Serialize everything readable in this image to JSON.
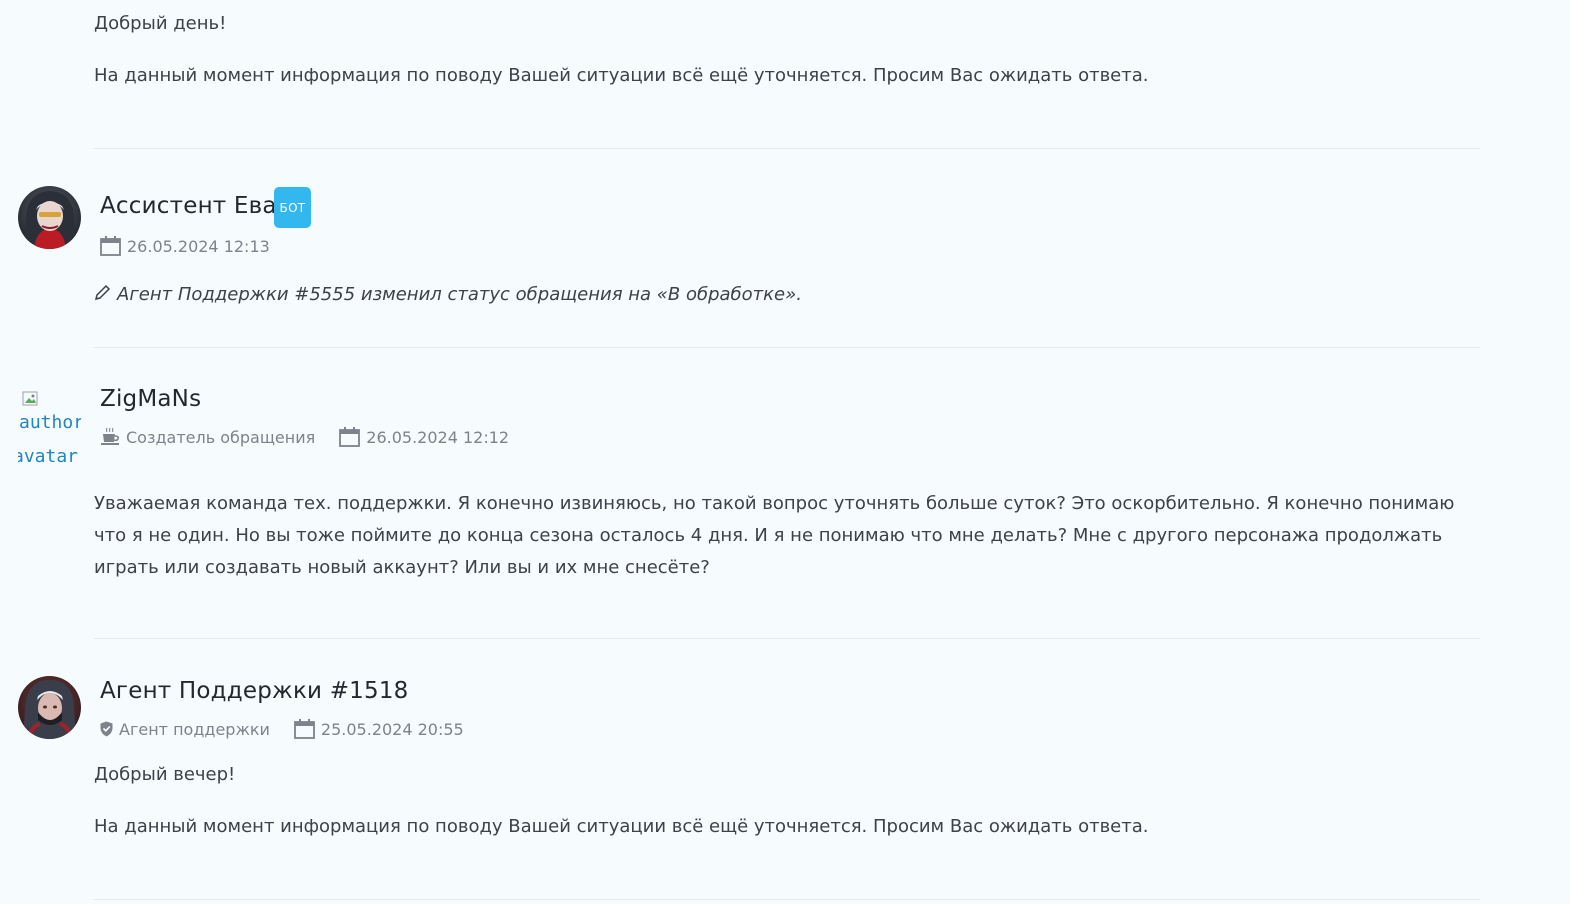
{
  "posts": [
    {
      "body": {
        "greeting": "Добрый день!",
        "text": "На данный момент информация по поводу Вашей ситуации всё ещё уточняется. Просим Вас ожидать ответа."
      }
    },
    {
      "author": "Ассистент Ева",
      "badge": "БОТ",
      "date": "26.05.2024 12:13",
      "status_note": "Агент Поддержки #5555 изменил статус обращения на «В обработке».",
      "avatar_icon": "avatar-eva-icon",
      "accent_color": "#32b8ef"
    },
    {
      "author": "ZigMaNs",
      "avatar_alt": "author avatar",
      "avatar_alt_line1": "author",
      "avatar_alt_line2": "avatar",
      "role": "Создатель обращения",
      "date": "26.05.2024 12:12",
      "body_text": "Уважаемая команда тех. поддержки. Я конечно извиняюсь, но такой вопрос уточнять больше суток? Это оскорбительно. Я конечно понимаю что я не один. Но вы тоже поймите до конца сезона осталось 4 дня. И я не понимаю что мне делать? Мне с другого персонажа продолжать играть или создавать новый аккаунт? Или вы и их мне снесёте?",
      "role_icon": "coffee-cup-icon"
    },
    {
      "author": "Агент Поддержки #1518",
      "role": "Агент поддержки",
      "date": "25.05.2024 20:55",
      "greeting": "Добрый вечер!",
      "text": "На данный момент информация по поводу Вашей ситуации всё ещё уточняется. Просим Вас ожидать ответа.",
      "role_icon": "shield-check-icon",
      "avatar_icon": "avatar-agent-icon"
    }
  ]
}
